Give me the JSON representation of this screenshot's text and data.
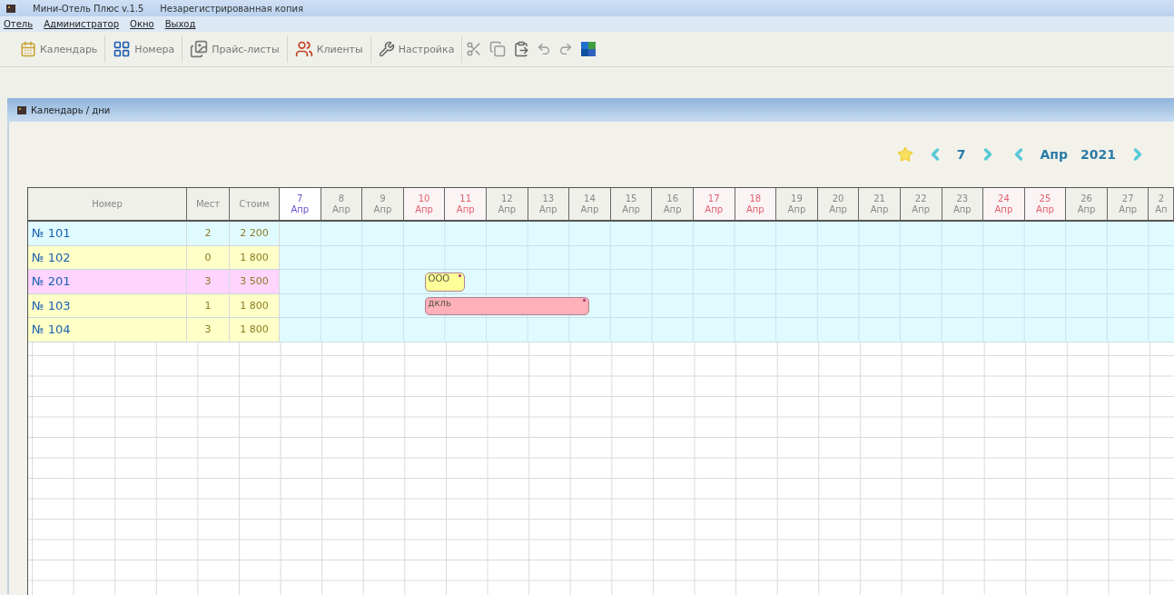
{
  "window": {
    "title": "Мини-Отель Плюс v.1.5",
    "subtitle": "Незарегистрированная копия"
  },
  "menu": [
    "Отель",
    "Администратор",
    "Окно",
    "Выход"
  ],
  "toolbar": [
    {
      "kind": "labeled",
      "label": "Календарь"
    },
    {
      "kind": "labeled",
      "label": "Номера"
    },
    {
      "kind": "labeled",
      "label": "Прайс-листы"
    },
    {
      "kind": "labeled",
      "label": "Клиенты"
    },
    {
      "kind": "labeled",
      "label": "Настройка"
    }
  ],
  "panel": {
    "title": "Календарь / дни",
    "nav": {
      "day": "7",
      "month": "Апр",
      "year": "2021"
    }
  },
  "table": {
    "columns": [
      "Номер",
      "Мест",
      "Стоим"
    ],
    "days": [
      {
        "day": "7",
        "month": "Апр",
        "kind": "today"
      },
      {
        "day": "8",
        "month": "Апр",
        "kind": "weekday"
      },
      {
        "day": "9",
        "month": "Апр",
        "kind": "weekday"
      },
      {
        "day": "10",
        "month": "Апр",
        "kind": "weekend"
      },
      {
        "day": "11",
        "month": "Апр",
        "kind": "weekend"
      },
      {
        "day": "12",
        "month": "Апр",
        "kind": "weekday"
      },
      {
        "day": "13",
        "month": "Апр",
        "kind": "weekday"
      },
      {
        "day": "14",
        "month": "Апр",
        "kind": "weekday"
      },
      {
        "day": "15",
        "month": "Апр",
        "kind": "weekday"
      },
      {
        "day": "16",
        "month": "Апр",
        "kind": "weekday"
      },
      {
        "day": "17",
        "month": "Апр",
        "kind": "weekend"
      },
      {
        "day": "18",
        "month": "Апр",
        "kind": "weekend"
      },
      {
        "day": "19",
        "month": "Апр",
        "kind": "weekday"
      },
      {
        "day": "20",
        "month": "Апр",
        "kind": "weekday"
      },
      {
        "day": "21",
        "month": "Апр",
        "kind": "weekday"
      },
      {
        "day": "22",
        "month": "Апр",
        "kind": "weekday"
      },
      {
        "day": "23",
        "month": "Апр",
        "kind": "weekday"
      },
      {
        "day": "24",
        "month": "Апр",
        "kind": "weekend"
      },
      {
        "day": "25",
        "month": "Апр",
        "kind": "weekend"
      },
      {
        "day": "26",
        "month": "Апр",
        "kind": "weekday"
      },
      {
        "day": "27",
        "month": "Апр",
        "kind": "weekday"
      },
      {
        "day": "2",
        "month": "Ап",
        "kind": "weekday"
      }
    ],
    "rows": [
      {
        "room": "№ 101",
        "beds": "2",
        "price": "2 200",
        "color": "#e0fbff",
        "bookings": []
      },
      {
        "room": "№ 102",
        "beds": "0",
        "price": "1 800",
        "color": "#ffffc8",
        "bookings": []
      },
      {
        "room": "№ 201",
        "beds": "3",
        "price": "3 500",
        "color": "#ffd4ff",
        "bookings": [
          {
            "label": "ООО",
            "color": "#ffff99"
          }
        ]
      },
      {
        "room": "№ 103",
        "beds": "1",
        "price": "1 800",
        "color": "#ffffc8",
        "bookings": [
          {
            "label": "дкль",
            "color": "#ffb0b8"
          }
        ]
      },
      {
        "room": "№ 104",
        "beds": "3",
        "price": "1 800",
        "color": "#ffffc8",
        "bookings": []
      }
    ]
  }
}
